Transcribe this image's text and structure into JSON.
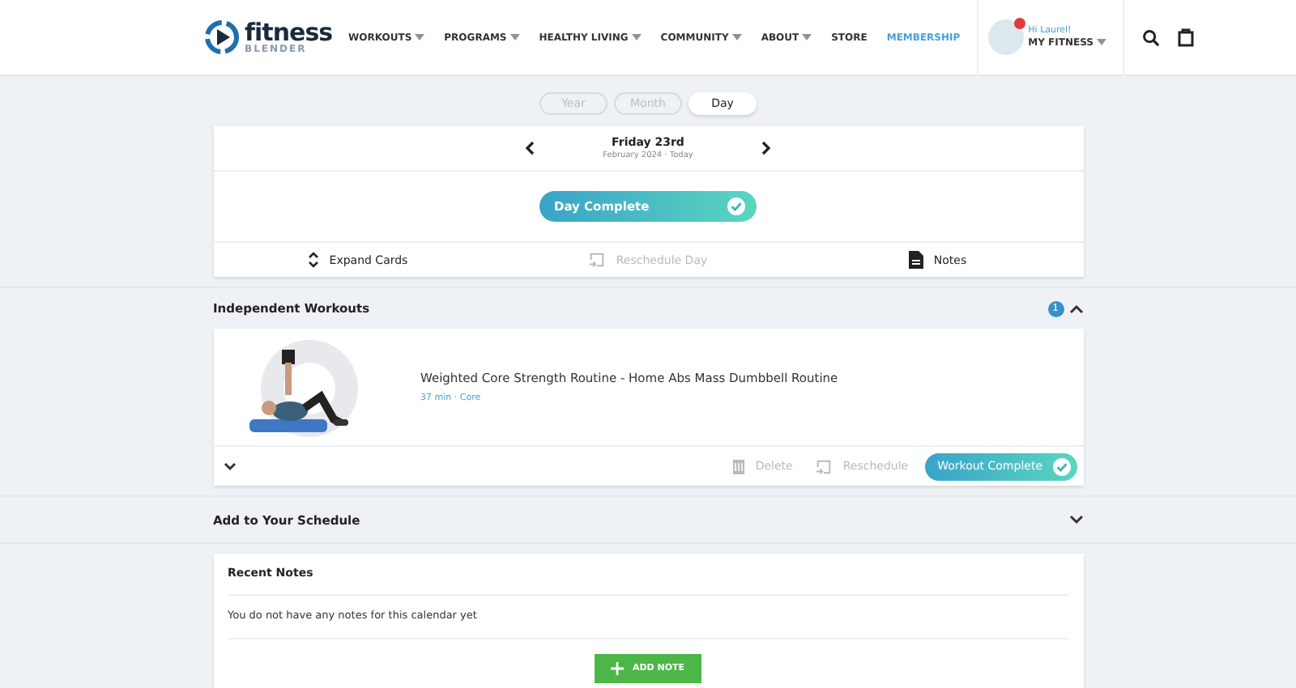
{
  "header": {
    "logo": {
      "name": "fitness",
      "sub": "BLENDER"
    },
    "nav": [
      {
        "label": "WORKOUTS",
        "dropdown": true,
        "highlighted": false
      },
      {
        "label": "PROGRAMS",
        "dropdown": true,
        "highlighted": false
      },
      {
        "label": "HEALTHY LIVING",
        "dropdown": true,
        "highlighted": false
      },
      {
        "label": "COMMUNITY",
        "dropdown": true,
        "highlighted": false
      },
      {
        "label": "ABOUT",
        "dropdown": true,
        "highlighted": false
      },
      {
        "label": "STORE",
        "dropdown": false,
        "highlighted": false
      },
      {
        "label": "MEMBERSHIP",
        "dropdown": false,
        "highlighted": true
      }
    ],
    "user": {
      "greeting": "Hi Laurel!",
      "menu": "MY FITNESS",
      "notification": true
    }
  },
  "view_tabs": [
    {
      "label": "Year",
      "selected": false
    },
    {
      "label": "Month",
      "selected": false
    },
    {
      "label": "Day",
      "selected": true
    }
  ],
  "day": {
    "title": "Friday 23rd",
    "subtitle": "February 2024 · Today",
    "complete_button": "Day Complete",
    "completed": true,
    "actions": [
      {
        "kind": "expand",
        "label": "Expand Cards",
        "disabled": false
      },
      {
        "kind": "reschedule",
        "label": "Reschedule Day",
        "disabled": true
      },
      {
        "kind": "notes",
        "label": "Notes",
        "disabled": false
      }
    ]
  },
  "independent": {
    "title": "Independent Workouts",
    "count": "1",
    "expanded": true,
    "workouts": [
      {
        "title": "Weighted Core Strength Routine - Home Abs Mass Dumbbell Routine",
        "meta": "37 min · Core",
        "thumbnail": {
          "kind": "picture"
        },
        "actions": [
          {
            "kind": "delete",
            "label": "Delete",
            "disabled": true
          },
          {
            "kind": "reschedule",
            "label": "Reschedule",
            "disabled": true
          }
        ],
        "complete_button": "Workout Complete",
        "completed": true
      }
    ]
  },
  "schedule": {
    "title": "Add to Your Schedule",
    "expanded": false
  },
  "notes": {
    "title": "Recent Notes",
    "empty": "You do not have any notes for this calendar yet",
    "add_button": "ADD NOTE"
  }
}
